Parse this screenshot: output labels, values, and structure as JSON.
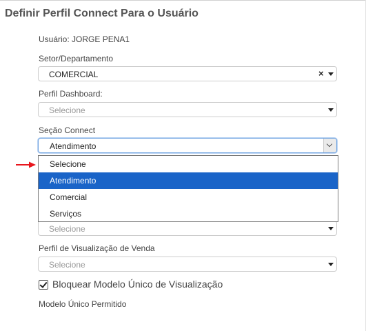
{
  "form": {
    "title": "Definir Perfil Connect Para o Usuário",
    "user_line": "Usuário: JORGE PENA1",
    "sector": {
      "label": "Setor/Departamento",
      "value": "COMERCIAL",
      "clear_glyph": "×"
    },
    "dashboard_profile": {
      "label": "Perfil Dashboard:",
      "placeholder": "Selecione"
    },
    "connect_section": {
      "label": "Seção Connect",
      "value": "Atendimento",
      "options": [
        "Selecione",
        "Atendimento",
        "Comercial",
        "Serviços"
      ],
      "highlighted_option": "Atendimento"
    },
    "hidden_select": {
      "placeholder": "Selecione"
    },
    "sales_view_profile": {
      "label": "Perfil de Visualização de Venda",
      "placeholder": "Selecione"
    },
    "lock_single_model": {
      "label": "Bloquear Modelo Único de Visualização",
      "checked": true
    },
    "allowed_model": {
      "label": "Modelo Único Permitido"
    }
  },
  "colors": {
    "highlight": "#1a64c8",
    "annotation_arrow": "#e8161d"
  }
}
